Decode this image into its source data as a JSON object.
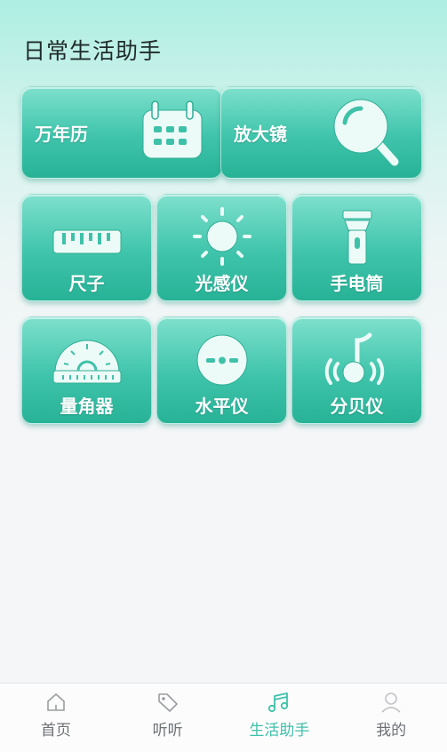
{
  "page": {
    "title": "日常生活助手"
  },
  "tools": {
    "calendar": "万年历",
    "magnifier": "放大镜",
    "ruler": "尺子",
    "light_meter": "光感仪",
    "flashlight": "手电筒",
    "protractor": "量角器",
    "level": "水平仪",
    "decibel": "分贝仪"
  },
  "tabbar": {
    "items": [
      {
        "label": "首页",
        "icon": "home-icon"
      },
      {
        "label": "听听",
        "icon": "tag-icon"
      },
      {
        "label": "生活助手",
        "icon": "music-note-icon",
        "active": true
      },
      {
        "label": "我的",
        "icon": "user-icon"
      }
    ]
  },
  "colors": {
    "accent": "#3fc1a9",
    "card_top": "#7ee0cd",
    "card_bottom": "#27b296",
    "tab_inactive": "#6e7175"
  }
}
